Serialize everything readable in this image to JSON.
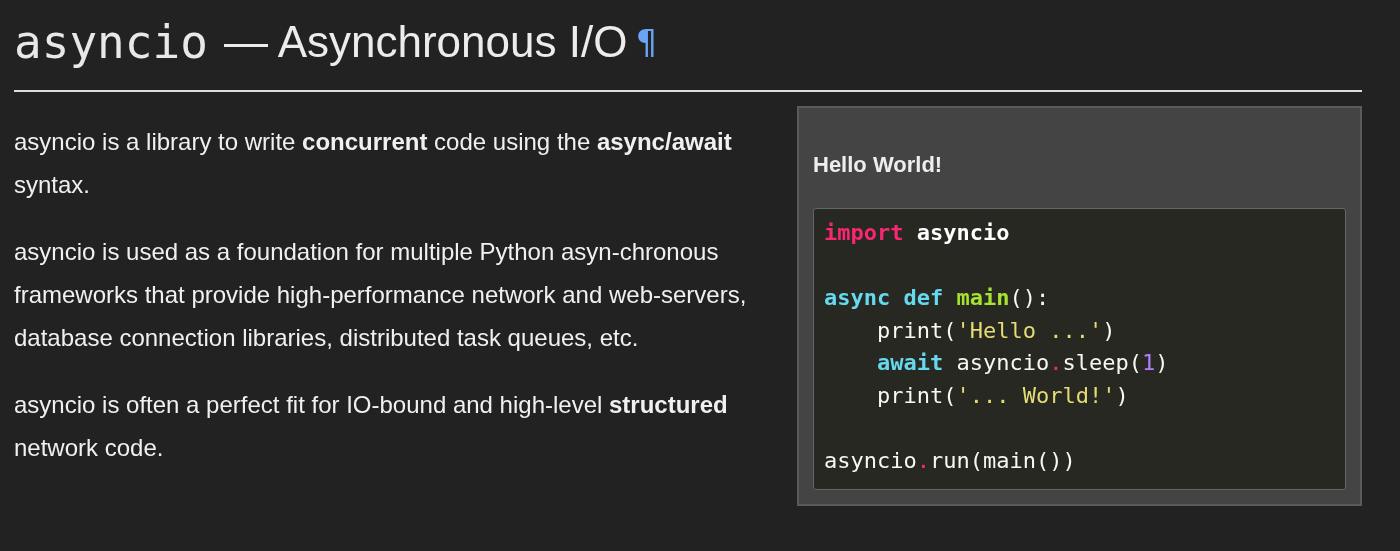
{
  "title": {
    "module": "asyncio",
    "text": "— Asynchronous I/O",
    "permalink": "¶"
  },
  "paragraphs": [
    "asyncio is a library to write **concurrent** code using the **async/await** syntax.",
    "asyncio is used as a foundation for multiple Python asyn-chronous frameworks that provide high-performance network and web-servers, database connection libraries, distributed task queues, etc.",
    "asyncio is often a perfect fit for IO-bound and high-level **structured** network code."
  ],
  "sidebar": {
    "title": "Hello World!",
    "code": [
      {
        "kind": "code",
        "tokens": [
          {
            "kind": "keyword",
            "text": "import "
          },
          {
            "kind": "module",
            "text": "asyncio"
          }
        ]
      },
      {
        "kind": "blank"
      },
      {
        "kind": "code",
        "tokens": [
          {
            "kind": "builtin",
            "text": "async def "
          },
          {
            "kind": "name",
            "text": "main"
          },
          {
            "kind": "plain",
            "text": "():"
          }
        ]
      },
      {
        "kind": "code",
        "tokens": [
          {
            "kind": "plain",
            "text": "    print("
          },
          {
            "kind": "string",
            "text": "'Hello ...'"
          },
          {
            "kind": "plain",
            "text": ")"
          }
        ]
      },
      {
        "kind": "code",
        "tokens": [
          {
            "kind": "builtin",
            "text": "    await"
          },
          {
            "kind": "plain",
            "text": " asyncio"
          },
          {
            "kind": "operator",
            "text": "."
          },
          {
            "kind": "plain",
            "text": "sleep("
          },
          {
            "kind": "number",
            "text": "1"
          },
          {
            "kind": "plain",
            "text": ")"
          }
        ]
      },
      {
        "kind": "code",
        "tokens": [
          {
            "kind": "plain",
            "text": "    print("
          },
          {
            "kind": "string",
            "text": "'... World!'"
          },
          {
            "kind": "plain",
            "text": ")"
          }
        ]
      },
      {
        "kind": "blank"
      },
      {
        "kind": "code",
        "tokens": [
          {
            "kind": "plain",
            "text": "asyncio"
          },
          {
            "kind": "operator",
            "text": "."
          },
          {
            "kind": "plain",
            "text": "run(main())"
          }
        ]
      }
    ]
  }
}
